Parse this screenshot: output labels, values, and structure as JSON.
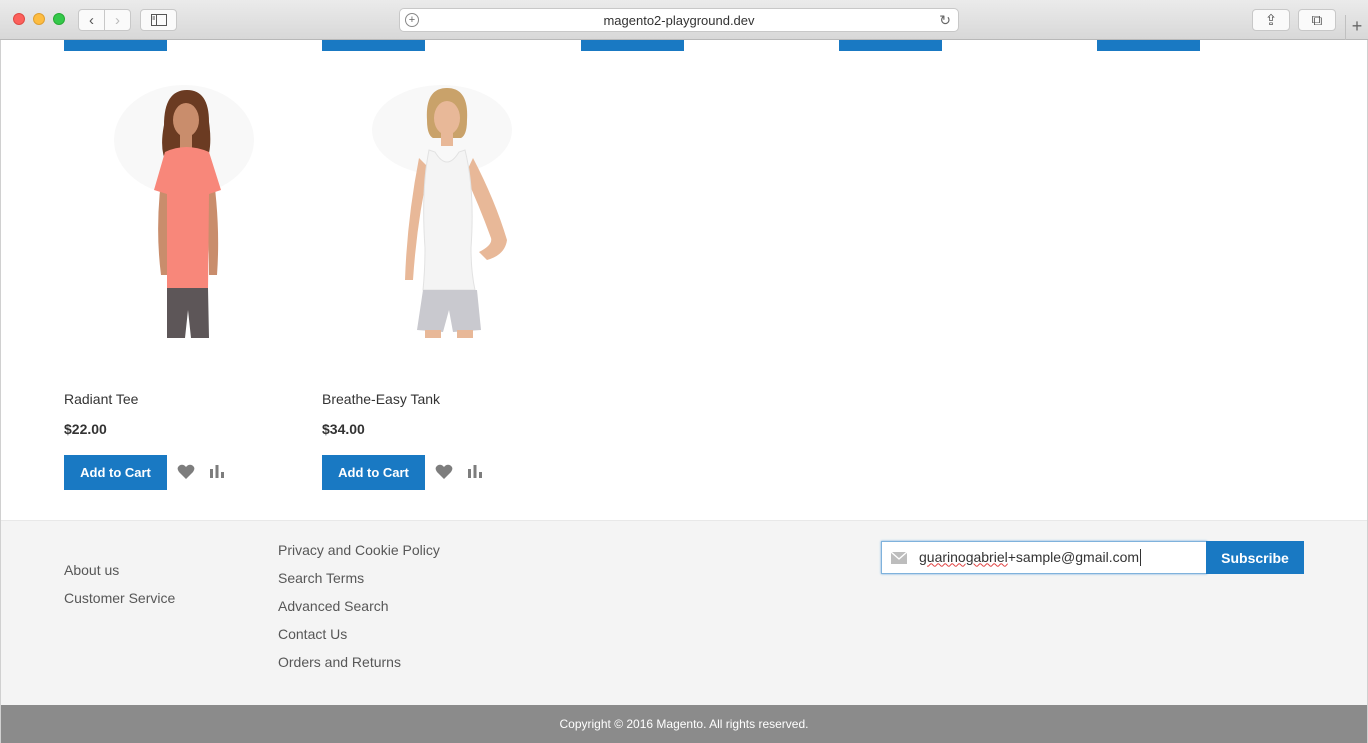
{
  "browser": {
    "url": "magento2-playground.dev",
    "back_glyph": "‹",
    "forward_glyph": "›",
    "reload_glyph": "↻",
    "share_glyph": "⇪",
    "tabs_glyph": "⧉",
    "new_tab_glyph": "+",
    "address_plus_glyph": "+"
  },
  "products": [
    {
      "name": "Radiant Tee",
      "price": "$22.00",
      "button": "Add to Cart",
      "shirt_color": "#f8877a"
    },
    {
      "name": "Breathe-Easy Tank",
      "price": "$34.00",
      "button": "Add to Cart",
      "shirt_color": "#f4f4f4"
    }
  ],
  "footer": {
    "col1": [
      "About us",
      "Customer Service"
    ],
    "col2": [
      "Privacy and Cookie Policy",
      "Search Terms",
      "Advanced Search",
      "Contact Us",
      "Orders and Returns"
    ],
    "newsletter": {
      "value_part1": "guarinogabriel",
      "value_part2": "+sample@gmail.com",
      "button": "Subscribe"
    },
    "copyright": "Copyright © 2016 Magento. All rights reserved."
  },
  "colors": {
    "accent": "#1979c3",
    "footer_bg": "#f4f4f4",
    "copyright_bg": "#8b8b8b"
  },
  "icons": {
    "wishlist": "heart-icon",
    "compare": "compare-bars-icon",
    "newsletter": "envelope-icon"
  }
}
